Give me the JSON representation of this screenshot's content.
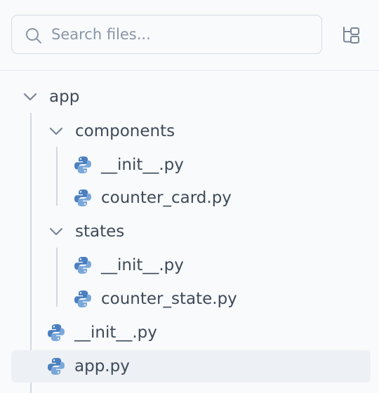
{
  "search": {
    "placeholder": "Search files...",
    "value": ""
  },
  "colors": {
    "python_blue": "#4b7fbf",
    "python_lightblue": "#7aa7d9",
    "selected_bg": "#edf0f4",
    "text": "#3f4a58",
    "icon_gray": "#7a8596"
  },
  "icons": {
    "search": "search-icon",
    "collapse_all": "collapse-tree-icon",
    "folder_open": "chevron-down-icon",
    "python_file": "python-file-icon"
  },
  "tree": {
    "root": {
      "label": "app",
      "expanded": true
    },
    "components": {
      "label": "components",
      "expanded": true
    },
    "components_init": {
      "label": "__init__.py"
    },
    "counter_card": {
      "label": "counter_card.py"
    },
    "states": {
      "label": "states",
      "expanded": true
    },
    "states_init": {
      "label": "__init__.py"
    },
    "counter_state": {
      "label": "counter_state.py"
    },
    "app_init": {
      "label": "__init__.py"
    },
    "app_py": {
      "label": "app.py",
      "selected": true
    }
  }
}
